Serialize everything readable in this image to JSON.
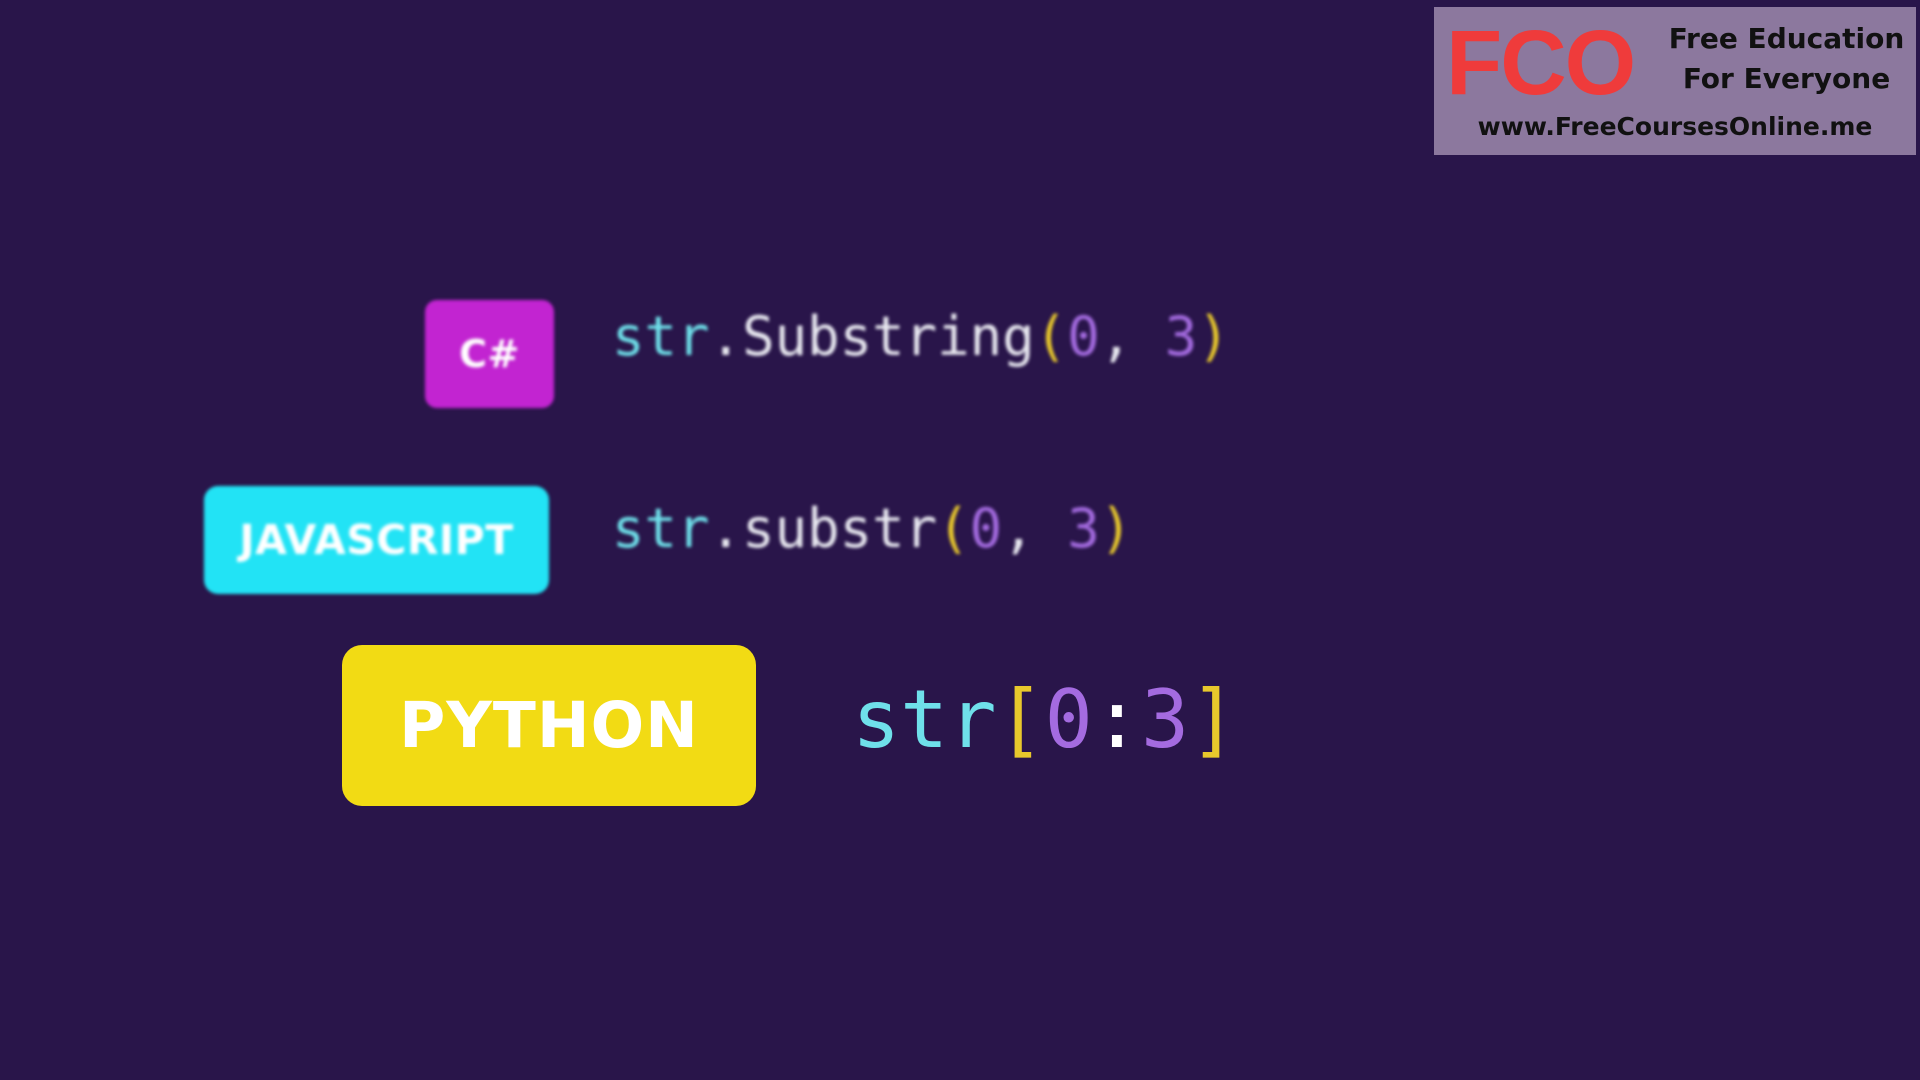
{
  "colors": {
    "background": "#29154a",
    "csharp_badge": "#c224d1",
    "javascript_badge": "#22e3f5",
    "python_badge": "#f2db14",
    "identifier": "#6fe0ea",
    "bracket": "#e8c82c",
    "number": "#a46be0",
    "logo_red": "#ef3b3b"
  },
  "rows": {
    "csharp": {
      "badge": "C#",
      "code": {
        "ident": "str",
        "dot": ".",
        "method": "Substring",
        "open": "(",
        "arg1": "0",
        "comma": ", ",
        "arg2": "3",
        "close": ")"
      }
    },
    "javascript": {
      "badge": "JAVASCRIPT",
      "code": {
        "ident": "str",
        "dot": ".",
        "method": "substr",
        "open": "(",
        "arg1": "0",
        "comma": ", ",
        "arg2": "3",
        "close": ")"
      }
    },
    "python": {
      "badge": "PYTHON",
      "code": {
        "ident": "str",
        "open": "[",
        "arg1": "0",
        "colon": ":",
        "arg2": "3",
        "close": "]"
      }
    }
  },
  "watermark": {
    "mark": "FCO",
    "tagline_line1": "Free Education",
    "tagline_line2": "For Everyone",
    "url": "www.FreeCoursesOnline.me"
  }
}
